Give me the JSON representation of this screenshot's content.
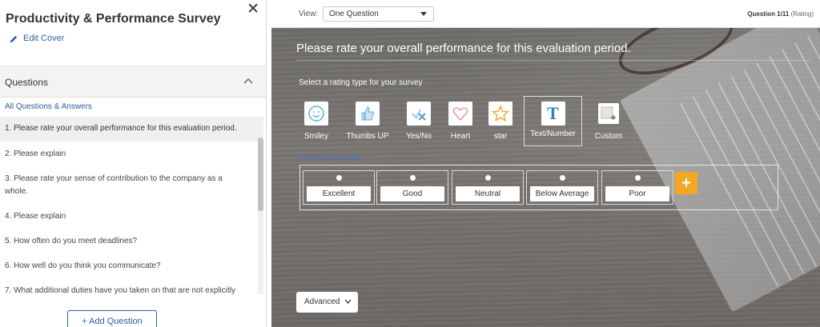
{
  "sidebar": {
    "survey_title": "Productivity & Performance Survey",
    "edit_cover": "Edit Cover",
    "questions_header": "Questions",
    "all_qa_link": "All Questions & Answers",
    "questions": [
      "1. Please rate your overall performance for this evaluation period.",
      "2. Please explain",
      "3. Please rate your sense of contribution to the company as a whole.",
      "4. Please explain",
      "5. How often do you meet deadlines?",
      "6. How well do you think you communicate?",
      "7. What additional duties have you taken on that are not explicitly"
    ],
    "add_question": "+ Add Question"
  },
  "topbar": {
    "view_label": "View:",
    "view_value": "One Question",
    "counter": "Question 1/11",
    "counter_type": "(Rating)"
  },
  "main": {
    "question_title": "Please rate your overall performance for this evaluation period.",
    "select_rating_label": "Select a rating type for your survey",
    "rating_types": [
      "Smiley",
      "Thumbs UP",
      "Yes/No",
      "Heart",
      "star",
      "Text/Number",
      "Custom"
    ],
    "selected_rating_type": "Text/Number",
    "change_template": "Change Template",
    "options": [
      "Excellent",
      "Good",
      "Neutral",
      "Below Average",
      "Poor"
    ],
    "add_option": "+",
    "advanced": "Advanced"
  },
  "colors": {
    "accent_blue": "#2c5f9e",
    "add_button_orange": "#f5a623",
    "template_link": "#4a73c5"
  }
}
